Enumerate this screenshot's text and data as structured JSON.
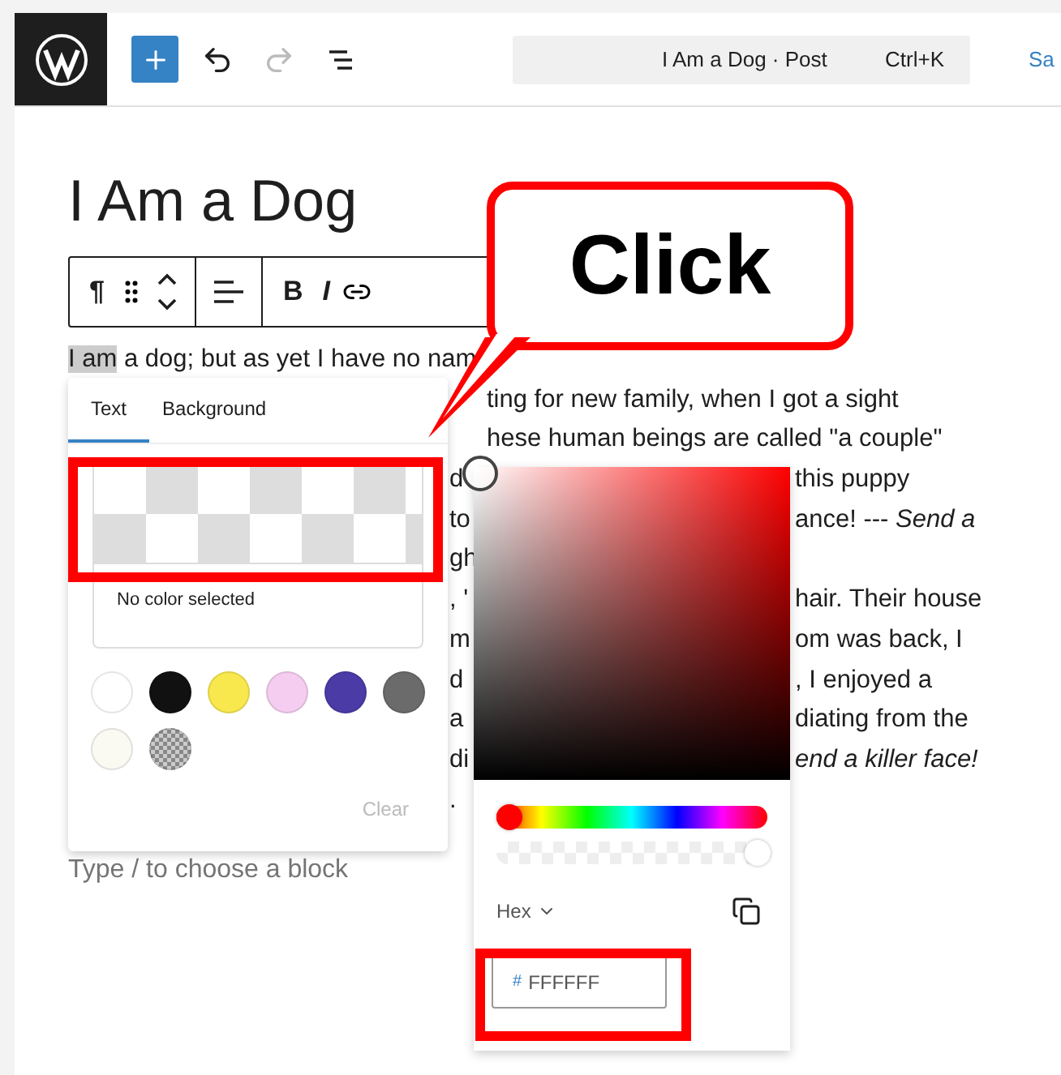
{
  "topbar": {
    "tools": [
      {
        "kind": "undo",
        "disabled": false
      },
      {
        "kind": "redo",
        "disabled": true
      },
      {
        "kind": "list-view",
        "disabled": false
      }
    ],
    "command": {
      "title": "I Am a Dog · Post",
      "shortcut": "Ctrl+K"
    },
    "save_link": "Sa"
  },
  "post_title": "I Am a Dog",
  "block_toolbar": {
    "paragraph_glyph": "¶",
    "format_buttons": [
      "B",
      "I"
    ]
  },
  "paragraph": {
    "highlight": "I am",
    "first_line": " a dog; but as yet I have no nam",
    "lines": [
      {
        "right": "ting for new family, when I got a sight"
      },
      {
        "right": "hese human beings are called \"a couple\""
      },
      {
        "left": "d",
        "right": "this puppy"
      },
      {
        "left": "to",
        "right": "ance! --- *Send a*"
      },
      {
        "left": "gh"
      },
      {
        "left": ", '",
        "right": "hair. Their house"
      },
      {
        "left": "m",
        "right": "om was back, I"
      },
      {
        "left": "d",
        "right": ", I enjoyed a"
      },
      {
        "left": "a",
        "right": "diating from the"
      },
      {
        "left": "di",
        "right": "*end a killer face!*"
      },
      {
        "left": "."
      }
    ]
  },
  "appender": "Type / to choose a block",
  "color_popover": {
    "tabs": [
      {
        "label": "Text",
        "selected": true
      },
      {
        "label": "Background",
        "selected": false
      }
    ],
    "current": "No color selected",
    "swatches": [
      {
        "kind": "solid",
        "color": "#ffffff"
      },
      {
        "kind": "solid",
        "color": "#111111"
      },
      {
        "kind": "solid",
        "color": "#f9e84d"
      },
      {
        "kind": "solid",
        "color": "#f4cdf0"
      },
      {
        "kind": "solid",
        "color": "#4b3ba6"
      },
      {
        "kind": "solid",
        "color": "#6b6b6b"
      },
      {
        "kind": "solid",
        "color": "#fafaf3"
      },
      {
        "kind": "pattern",
        "color": "#888888"
      }
    ],
    "clear": {
      "label": "Clear",
      "disabled": true
    }
  },
  "picker": {
    "hue": {
      "level": 0
    },
    "alpha": {
      "level": 1
    },
    "format": "Hex",
    "hex": {
      "prefix": "#",
      "value": "FFFFFF"
    }
  },
  "callout": "Click"
}
